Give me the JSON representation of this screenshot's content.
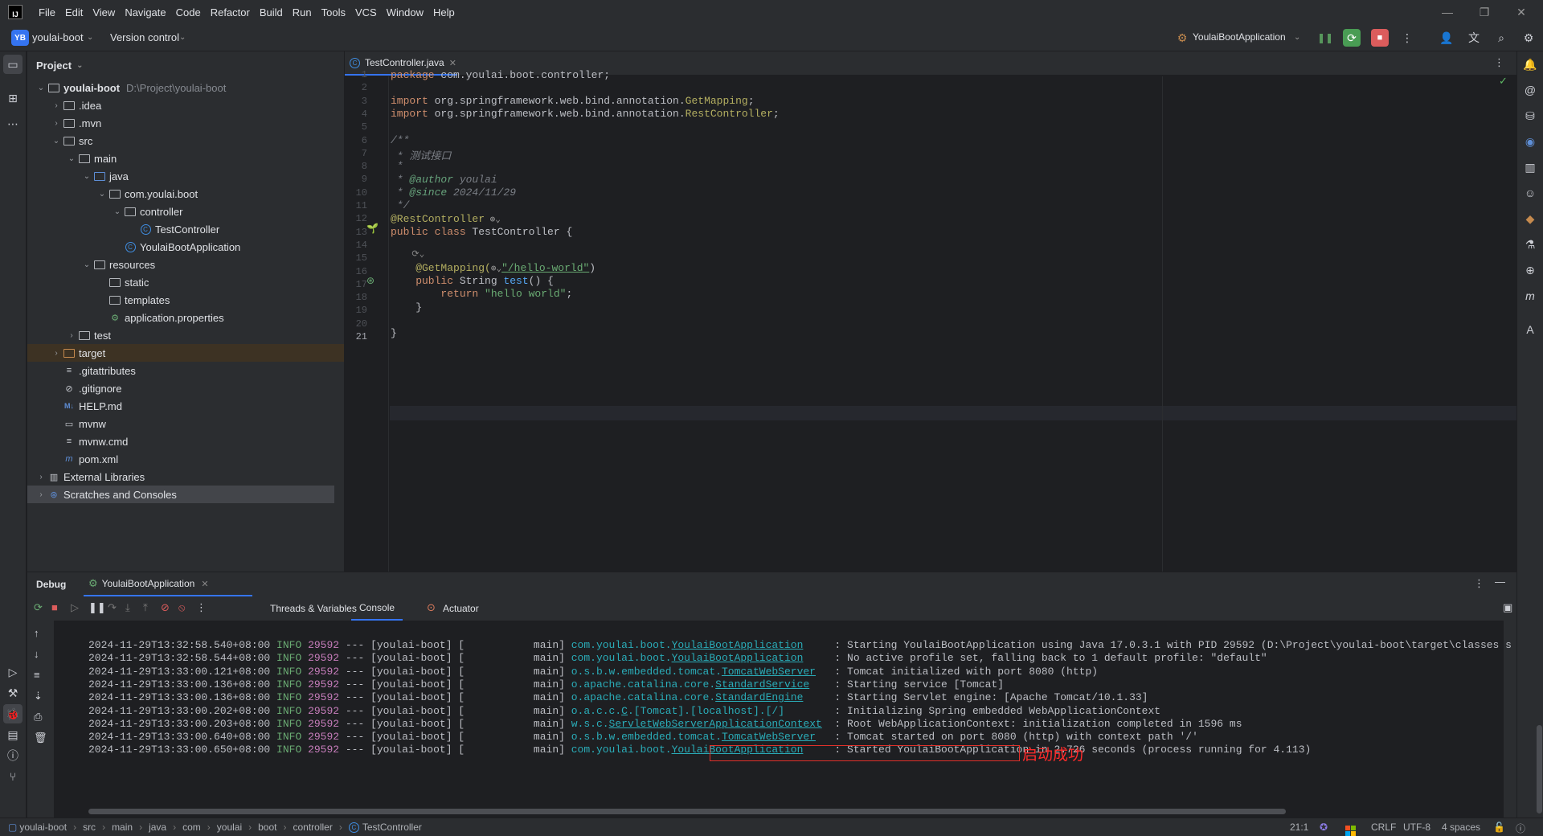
{
  "menubar": {
    "logo": "IJ",
    "items": [
      "File",
      "Edit",
      "View",
      "Navigate",
      "Code",
      "Refactor",
      "Build",
      "Run",
      "Tools",
      "VCS",
      "Window",
      "Help"
    ]
  },
  "toolbar": {
    "project_badge": "YB",
    "project_name": "youlai-boot",
    "vcs_label": "Version control",
    "run_config": "YoulaiBootApplication"
  },
  "project_panel": {
    "title": "Project",
    "tree": [
      {
        "label": "youlai-boot",
        "hint": "D:\\Project\\youlai-boot",
        "depth": 0,
        "arrow": "open",
        "icon": "folder",
        "bold": true
      },
      {
        "label": ".idea",
        "depth": 1,
        "arrow": "closed",
        "icon": "folder"
      },
      {
        "label": ".mvn",
        "depth": 1,
        "arrow": "closed",
        "icon": "folder"
      },
      {
        "label": "src",
        "depth": 1,
        "arrow": "open",
        "icon": "folder"
      },
      {
        "label": "main",
        "depth": 2,
        "arrow": "open",
        "icon": "folder"
      },
      {
        "label": "java",
        "depth": 3,
        "arrow": "open",
        "icon": "folder-blue"
      },
      {
        "label": "com.youlai.boot",
        "depth": 4,
        "arrow": "open",
        "icon": "package"
      },
      {
        "label": "controller",
        "depth": 5,
        "arrow": "open",
        "icon": "package"
      },
      {
        "label": "TestController",
        "depth": 6,
        "arrow": "none",
        "icon": "class"
      },
      {
        "label": "YoulaiBootApplication",
        "depth": 5,
        "arrow": "none",
        "icon": "class"
      },
      {
        "label": "resources",
        "depth": 3,
        "arrow": "open",
        "icon": "folder"
      },
      {
        "label": "static",
        "depth": 4,
        "arrow": "none",
        "icon": "folder"
      },
      {
        "label": "templates",
        "depth": 4,
        "arrow": "none",
        "icon": "folder"
      },
      {
        "label": "application.properties",
        "depth": 4,
        "arrow": "none",
        "icon": "props"
      },
      {
        "label": "test",
        "depth": 2,
        "arrow": "closed",
        "icon": "folder"
      },
      {
        "label": "target",
        "depth": 1,
        "arrow": "closed",
        "icon": "folder-orange",
        "highlight": true
      },
      {
        "label": ".gitattributes",
        "depth": 1,
        "arrow": "none",
        "icon": "text"
      },
      {
        "label": ".gitignore",
        "depth": 1,
        "arrow": "none",
        "icon": "ignore"
      },
      {
        "label": "HELP.md",
        "depth": 1,
        "arrow": "none",
        "icon": "md"
      },
      {
        "label": "mvnw",
        "depth": 1,
        "arrow": "none",
        "icon": "shell"
      },
      {
        "label": "mvnw.cmd",
        "depth": 1,
        "arrow": "none",
        "icon": "text"
      },
      {
        "label": "pom.xml",
        "depth": 1,
        "arrow": "none",
        "icon": "maven"
      },
      {
        "label": "External Libraries",
        "depth": 0,
        "arrow": "closed",
        "icon": "lib"
      },
      {
        "label": "Scratches and Consoles",
        "depth": 0,
        "arrow": "closed",
        "icon": "scratch",
        "selected": true
      }
    ]
  },
  "editor": {
    "tab_label": "TestController.java",
    "line_numbers": [
      "1",
      "2",
      "3",
      "4",
      "5",
      "6",
      "7",
      "8",
      "9",
      "10",
      "11",
      "12",
      "13",
      "14",
      "15",
      "16",
      "17",
      "18",
      "19",
      "20",
      "21"
    ],
    "lines": {
      "l1_kw": "package",
      "l1_rest": " com.youlai.boot.controller;",
      "l3_kw": "import",
      "l3_rest": " org.springframework.web.bind.annotation.",
      "l3_cls": "GetMapping",
      "l3_end": ";",
      "l4_kw": "import",
      "l4_rest": " org.springframework.web.bind.annotation.",
      "l4_cls": "RestController",
      "l4_end": ";",
      "l6": "/**",
      "l7": " * 测试接口",
      "l8": " *",
      "l9_a": " * ",
      "l9_tag": "@author",
      "l9_b": " youlai",
      "l10_a": " * ",
      "l10_tag": "@since",
      "l10_b": " 2024/11/29",
      "l11": " */",
      "l12": "@RestController",
      "l13_kw": "public class",
      "l13_rest": " TestController {",
      "l15_ann": "    @GetMapping(",
      "l15_str": "\"/hello-world\"",
      "l15_end": ")",
      "l16_kw": "    public",
      "l16_mid": " String ",
      "l16_fn": "test",
      "l16_end": "() {",
      "l17_kw": "        return",
      "l17_str": " \"hello world\"",
      "l17_end": ";",
      "l18": "    }",
      "l20": "}"
    }
  },
  "debug": {
    "title": "Debug",
    "session_tab": "YoulaiBootApplication",
    "tabs": [
      "Threads & Variables",
      "Console",
      "Actuator"
    ],
    "log_lines": [
      {
        "ts": "2024-11-29T13:32:58.540+08:00",
        "level": "INFO",
        "pid": "29592",
        "thread": "--- [youlai-boot] [           main] ",
        "logger_pre": "com.youlai.boot.",
        "logger_u": "YoulaiBootApplication",
        "logger_post": "    ",
        "msg": ": Starting YoulaiBootApplication using Java 17.0.3.1 with PID 29592 (D:\\Project\\youlai-boot\\target\\classes s"
      },
      {
        "ts": "2024-11-29T13:32:58.544+08:00",
        "level": "INFO",
        "pid": "29592",
        "thread": "--- [youlai-boot] [           main] ",
        "logger_pre": "com.youlai.boot.",
        "logger_u": "YoulaiBootApplication",
        "logger_post": "    ",
        "msg": ": No active profile set, falling back to 1 default profile: \"default\""
      },
      {
        "ts": "2024-11-29T13:33:00.121+08:00",
        "level": "INFO",
        "pid": "29592",
        "thread": "--- [youlai-boot] [           main] ",
        "logger_pre": "o.s.b.w.embedded.tomcat.",
        "logger_u": "TomcatWebServer",
        "logger_post": "  ",
        "msg": ": Tomcat initialized with port 8080 (http)"
      },
      {
        "ts": "2024-11-29T13:33:00.136+08:00",
        "level": "INFO",
        "pid": "29592",
        "thread": "--- [youlai-boot] [           main] ",
        "logger_pre": "o.apache.catalina.core.",
        "logger_u": "StandardService",
        "logger_post": "   ",
        "msg": ": Starting service [Tomcat]"
      },
      {
        "ts": "2024-11-29T13:33:00.136+08:00",
        "level": "INFO",
        "pid": "29592",
        "thread": "--- [youlai-boot] [           main] ",
        "logger_pre": "o.apache.catalina.core.",
        "logger_u": "StandardEngine",
        "logger_post": "    ",
        "msg": ": Starting Servlet engine: [Apache Tomcat/10.1.33]"
      },
      {
        "ts": "2024-11-29T13:33:00.202+08:00",
        "level": "INFO",
        "pid": "29592",
        "thread": "--- [youlai-boot] [           main] ",
        "logger_pre": "o.a.c.c.",
        "logger_u": "C",
        "logger_post": ".[Tomcat].[localhost].[/]       ",
        "msg": ": Initializing Spring embedded WebApplicationContext"
      },
      {
        "ts": "2024-11-29T13:33:00.203+08:00",
        "level": "INFO",
        "pid": "29592",
        "thread": "--- [youlai-boot] [           main] ",
        "logger_pre": "w.s.c.",
        "logger_u": "ServletWebServerApplicationContext",
        "logger_post": " ",
        "msg": ": Root WebApplicationContext: initialization completed in 1596 ms"
      },
      {
        "ts": "2024-11-29T13:33:00.640+08:00",
        "level": "INFO",
        "pid": "29592",
        "thread": "--- [youlai-boot] [           main] ",
        "logger_pre": "o.s.b.w.embedded.tomcat.",
        "logger_u": "TomcatWebServer",
        "logger_post": "  ",
        "msg": ": Tomcat started on port 8080 (http) with context path '/'"
      },
      {
        "ts": "2024-11-29T13:33:00.650+08:00",
        "level": "INFO",
        "pid": "29592",
        "thread": "--- [youlai-boot] [           main] ",
        "logger_pre": "com.youlai.boot.",
        "logger_u": "YoulaiBootApplication",
        "logger_post": "    ",
        "msg": ": Started YoulaiBootApplication in 2.726 seconds (process running for 4.113)"
      }
    ],
    "annotation": "启动成功"
  },
  "statusbar": {
    "breadcrumb": [
      "youlai-boot",
      "src",
      "main",
      "java",
      "com",
      "youlai",
      "boot",
      "controller",
      "TestController"
    ],
    "position": "21:1",
    "line_ending": "CRLF",
    "encoding": "UTF-8",
    "indent": "4 spaces"
  },
  "colors": {
    "accent": "#3574f0",
    "annotation_red": "#ff2b2b",
    "run_green": "#499c54",
    "stop_red": "#db5c5c"
  }
}
